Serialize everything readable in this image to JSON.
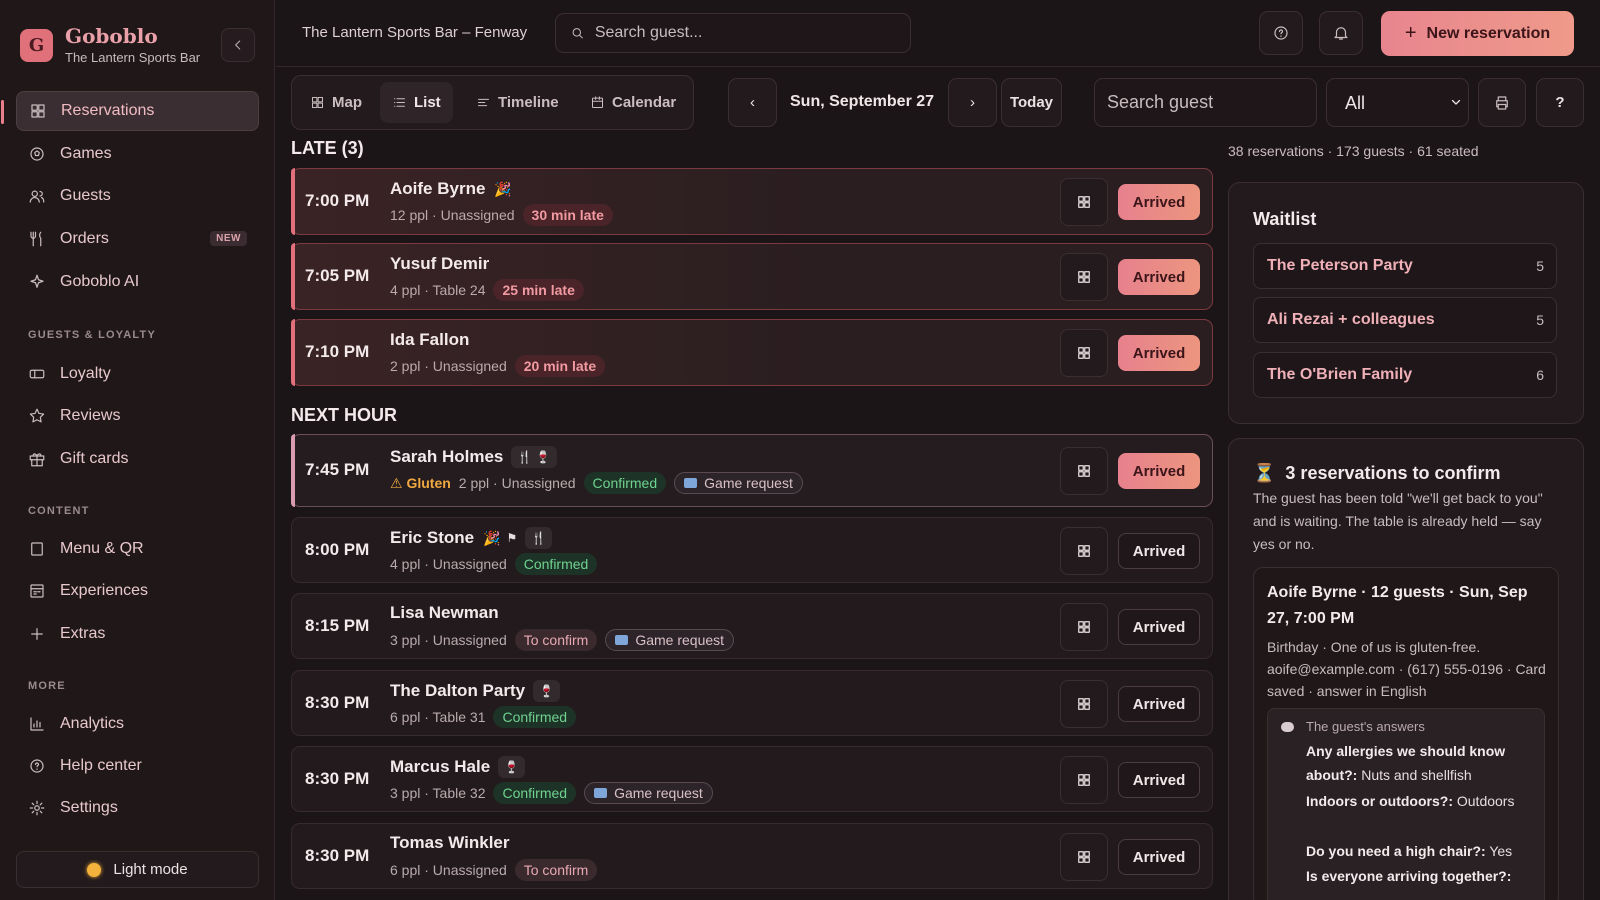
{
  "brand": {
    "logo_letter": "G",
    "name": "Goboblo",
    "subtitle": "The Lantern Sports Bar"
  },
  "sidebar": {
    "nav_main": [
      {
        "label": "Reservations",
        "icon": "grid-icon",
        "active": true
      },
      {
        "label": "Games",
        "icon": "ball-icon"
      },
      {
        "label": "Guests",
        "icon": "users-icon"
      },
      {
        "label": "Orders",
        "icon": "utensils-icon",
        "badge": "NEW"
      },
      {
        "label": "Goboblo AI",
        "icon": "sparkle-icon"
      }
    ],
    "section_guests": "GUESTS & LOYALTY",
    "nav_guests": [
      {
        "label": "Loyalty",
        "icon": "ticket-icon"
      },
      {
        "label": "Reviews",
        "icon": "star-icon"
      },
      {
        "label": "Gift cards",
        "icon": "gift-icon"
      }
    ],
    "section_content": "CONTENT",
    "nav_content": [
      {
        "label": "Menu & QR",
        "icon": "book-icon"
      },
      {
        "label": "Experiences",
        "icon": "calendar-grid-icon"
      },
      {
        "label": "Extras",
        "icon": "plus-icon"
      }
    ],
    "section_more": "MORE",
    "nav_more": [
      {
        "label": "Analytics",
        "icon": "chart-icon"
      },
      {
        "label": "Help center",
        "icon": "help-icon"
      },
      {
        "label": "Settings",
        "icon": "gear-icon"
      }
    ],
    "light_mode_label": "Light mode"
  },
  "topbar": {
    "venue": "The Lantern Sports Bar – Fenway",
    "search_placeholder": "Search guest...",
    "new_reservation_label": "New reservation"
  },
  "toolbar": {
    "views": [
      "Map",
      "List",
      "Timeline",
      "Calendar"
    ],
    "active_view": "List",
    "prev_glyph": "‹",
    "next_glyph": "›",
    "date": "Sun, September 27",
    "today_label": "Today",
    "guest_search_placeholder": "Search guest",
    "filter_value": "All",
    "help_glyph": "?"
  },
  "sections": {
    "late": "LATE (3)",
    "next_hour": "NEXT HOUR"
  },
  "reservations": [
    {
      "time": "7:00 PM",
      "name": "Aoife Byrne",
      "meta": "12 ppl · Unassigned",
      "late": "30 min late",
      "arrived": "Arrived"
    },
    {
      "time": "7:05 PM",
      "name": "Yusuf Demir",
      "meta": "4 ppl · Table 24",
      "late": "25 min late",
      "arrived": "Arrived"
    },
    {
      "time": "7:10 PM",
      "name": "Ida Fallon",
      "meta": "2 ppl · Unassigned",
      "late": "20 min late",
      "arrived": "Arrived"
    },
    {
      "time": "7:45 PM",
      "name": "Sarah Holmes",
      "allergy": "Gluten",
      "meta": "2 ppl · Unassigned",
      "status": "Confirmed",
      "game": "Game request",
      "arrived": "Arrived"
    },
    {
      "time": "8:00 PM",
      "name": "Eric Stone",
      "meta": "4 ppl · Unassigned",
      "status": "Confirmed",
      "arrived": "Arrived"
    },
    {
      "time": "8:15 PM",
      "name": "Lisa Newman",
      "meta": "3 ppl · Unassigned",
      "status": "To confirm",
      "game": "Game request",
      "arrived": "Arrived"
    },
    {
      "time": "8:30 PM",
      "name": "The Dalton Party",
      "meta": "6 ppl · Table 31",
      "status": "Confirmed",
      "arrived": "Arrived"
    },
    {
      "time": "8:30 PM",
      "name": "Marcus Hale",
      "meta": "3 ppl · Table 32",
      "status": "Confirmed",
      "game": "Game request",
      "arrived": "Arrived"
    },
    {
      "time": "8:30 PM",
      "name": "Tomas Winkler",
      "meta": "6 ppl · Unassigned",
      "status": "To confirm",
      "arrived": "Arrived"
    }
  ],
  "stats": "38 reservations · 173 guests · 61 seated",
  "waitlist": {
    "title": "Waitlist",
    "items": [
      {
        "name": "The Peterson Party",
        "count": "5"
      },
      {
        "name": "Ali Rezai + colleagues",
        "count": "5"
      },
      {
        "name": "The O'Brien Family",
        "count": "6"
      }
    ]
  },
  "confirm": {
    "title": "3 reservations to confirm",
    "description": "The guest has been told \"we'll get back to you\" and is waiting. The table is already held — say yes or no.",
    "card_heading": "Aoife Byrne · 12 guests · Sun, Sep 27, 7:00 PM",
    "card_info": "Birthday · One of us is gluten-free. aoife@example.com · (617) 555-0196 · Card saved · answer in English",
    "answers_label": "The guest's answers",
    "answers": [
      {
        "q": "Any allergies we should know about?:",
        "a": "Nuts and shellfish"
      },
      {
        "q": "Indoors or outdoors?:",
        "a": "Outdoors"
      },
      {
        "q": "Do you need a high chair?:",
        "a": "Yes"
      },
      {
        "q": "Is everyone arriving together?:",
        "a": ""
      }
    ]
  }
}
